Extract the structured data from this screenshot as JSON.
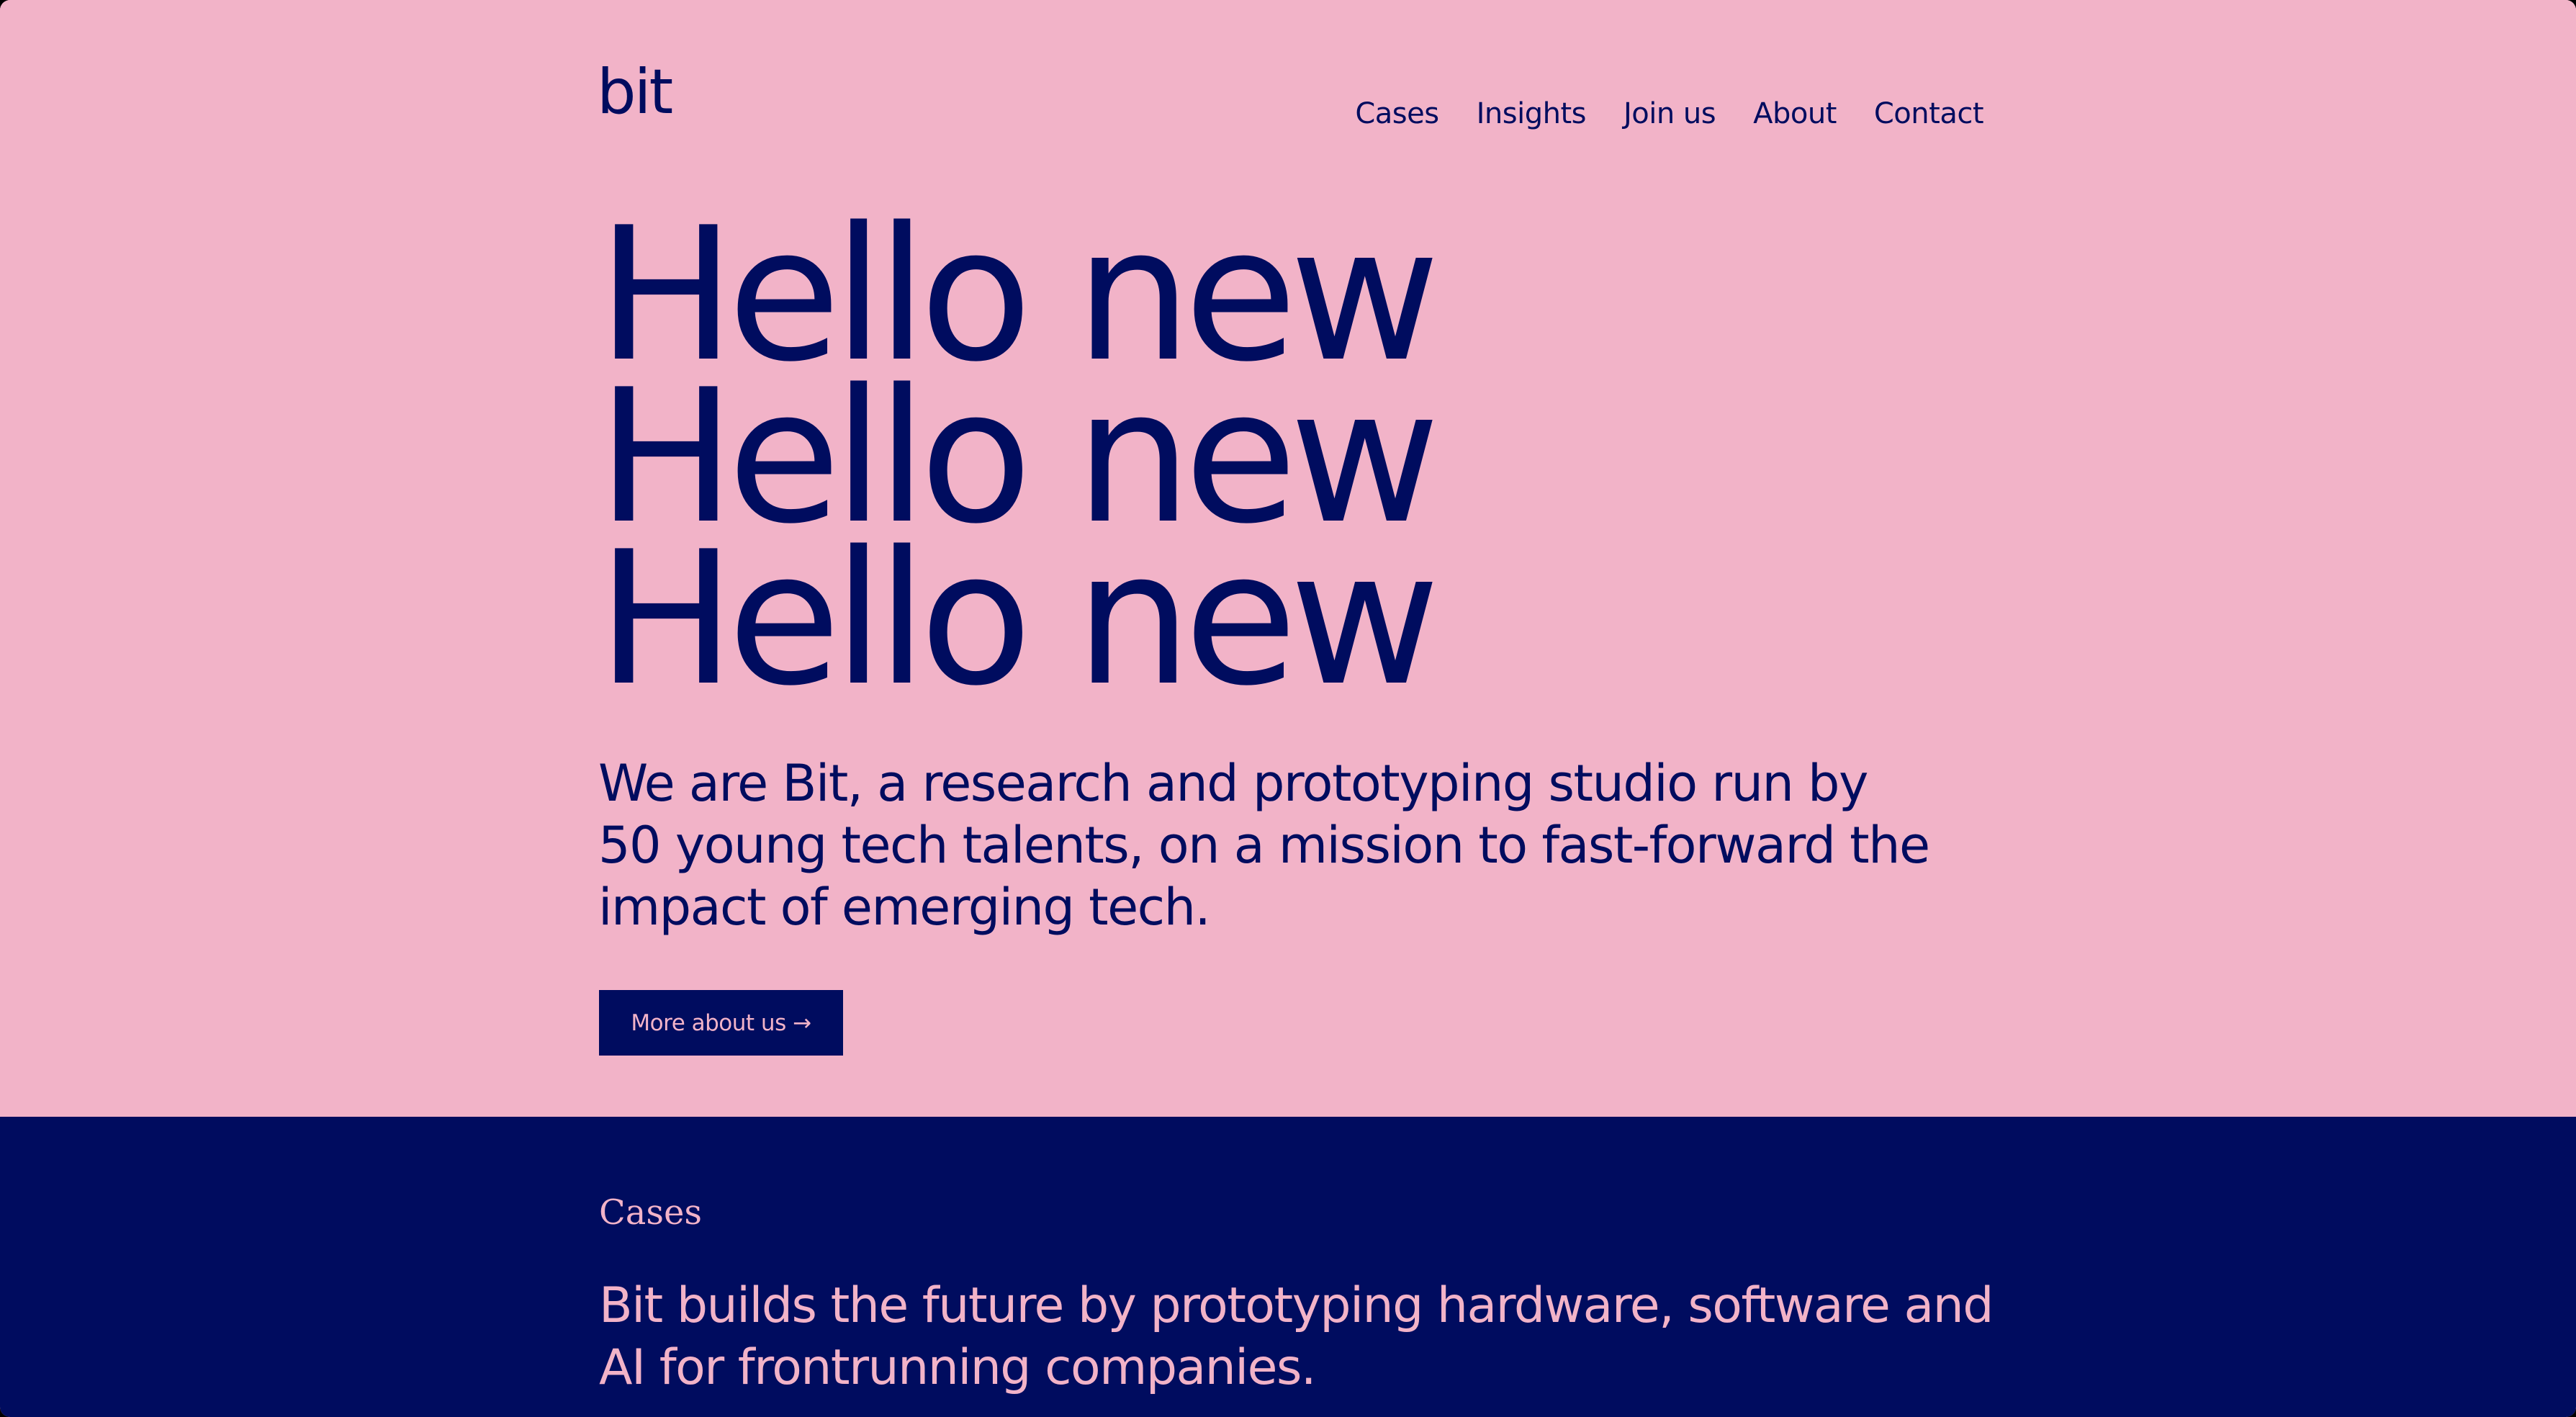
{
  "brand": {
    "logo_text": "bit"
  },
  "nav": {
    "items": [
      {
        "label": "Cases"
      },
      {
        "label": "Insights"
      },
      {
        "label": "Join us"
      },
      {
        "label": "About"
      },
      {
        "label": "Contact"
      }
    ]
  },
  "hero": {
    "headline_lines": [
      "Hello new",
      "Hello new",
      "Hello new"
    ],
    "intro": "We are Bit, a research and prototyping studio run by 50 young tech talents, on a mission to fast-forward the impact of emerging tech.",
    "cta_label": "More about us →"
  },
  "cases": {
    "label": "Cases",
    "text": "Bit builds the future by prototyping hardware, software and AI for frontrunning companies."
  },
  "colors": {
    "pink": "#F2B3C8",
    "navy": "#000C5F"
  }
}
